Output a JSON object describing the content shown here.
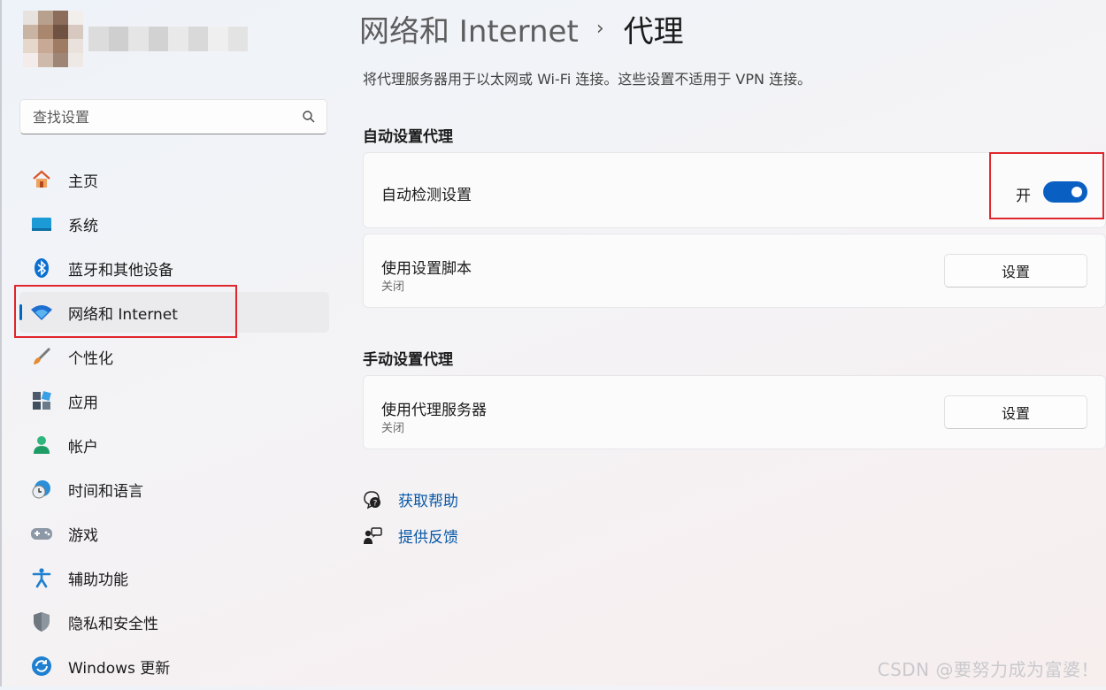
{
  "search": {
    "placeholder": "查找设置",
    "icon": "search-icon"
  },
  "sidebar": {
    "items": [
      {
        "label": "主页",
        "icon": "home-icon"
      },
      {
        "label": "系统",
        "icon": "system-icon"
      },
      {
        "label": "蓝牙和其他设备",
        "icon": "bluetooth-icon"
      },
      {
        "label": "网络和 Internet",
        "icon": "wifi-icon",
        "active": true
      },
      {
        "label": "个性化",
        "icon": "brush-icon"
      },
      {
        "label": "应用",
        "icon": "apps-icon"
      },
      {
        "label": "帐户",
        "icon": "account-icon"
      },
      {
        "label": "时间和语言",
        "icon": "time-language-icon"
      },
      {
        "label": "游戏",
        "icon": "gamepad-icon"
      },
      {
        "label": "辅助功能",
        "icon": "accessibility-icon"
      },
      {
        "label": "隐私和安全性",
        "icon": "shield-icon"
      },
      {
        "label": "Windows 更新",
        "icon": "update-icon"
      }
    ]
  },
  "header": {
    "breadcrumb_parent": "网络和 Internet",
    "separator": "›",
    "title": "代理"
  },
  "main": {
    "description": "将代理服务器用于以太网或 Wi-Fi 连接。这些设置不适用于 VPN 连接。",
    "auto_section": "自动设置代理",
    "auto_detect": {
      "label": "自动检测设置",
      "state_label": "开",
      "on": true
    },
    "setup_script": {
      "label": "使用设置脚本",
      "status": "关闭",
      "button": "设置"
    },
    "manual_section": "手动设置代理",
    "proxy_server": {
      "label": "使用代理服务器",
      "status": "关闭",
      "button": "设置"
    },
    "help_link": "获取帮助",
    "feedback_link": "提供反馈"
  },
  "watermark": "CSDN @要努力成为富婆！",
  "colors": {
    "accent": "#0a5fc2",
    "highlight_box": "#e0252c",
    "link": "#0a5aa8"
  }
}
